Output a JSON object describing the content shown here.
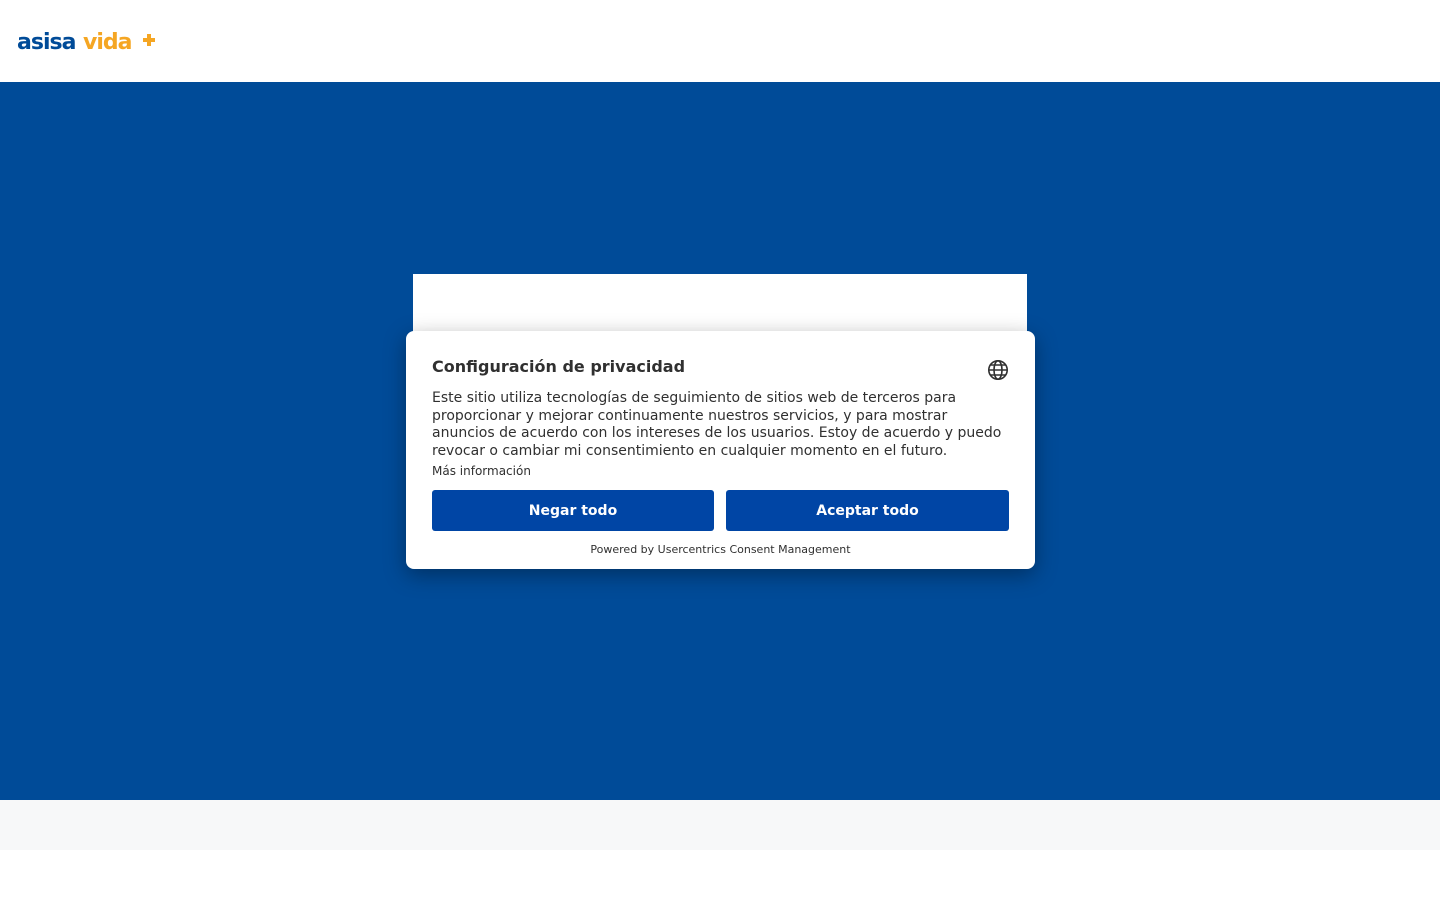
{
  "header": {
    "logo": {
      "primary_text": "asisa",
      "secondary_text": "vida",
      "symbol": "+",
      "primary_color": "#004b98",
      "secondary_color": "#f5a623"
    }
  },
  "colors": {
    "hero_background": "#004b98",
    "button_background": "#0045a5",
    "text": "#303030",
    "footer_band": "#f7f8f9"
  },
  "consent": {
    "title": "Configuración de privacidad",
    "language_icon": "globe-icon",
    "body": "Este sitio utiliza tecnologías de seguimiento de sitios web de terceros para proporcionar y mejorar continuamente nuestros servicios, y para mostrar anuncios de acuerdo con los intereses de los usuarios. Estoy de acuerdo y puedo revocar o cambiar mi consentimiento en cualquier momento en el futuro.",
    "more_info": "Más información",
    "deny_label": "Negar todo",
    "accept_label": "Aceptar todo",
    "powered_by": "Powered by Usercentrics Consent Management"
  }
}
